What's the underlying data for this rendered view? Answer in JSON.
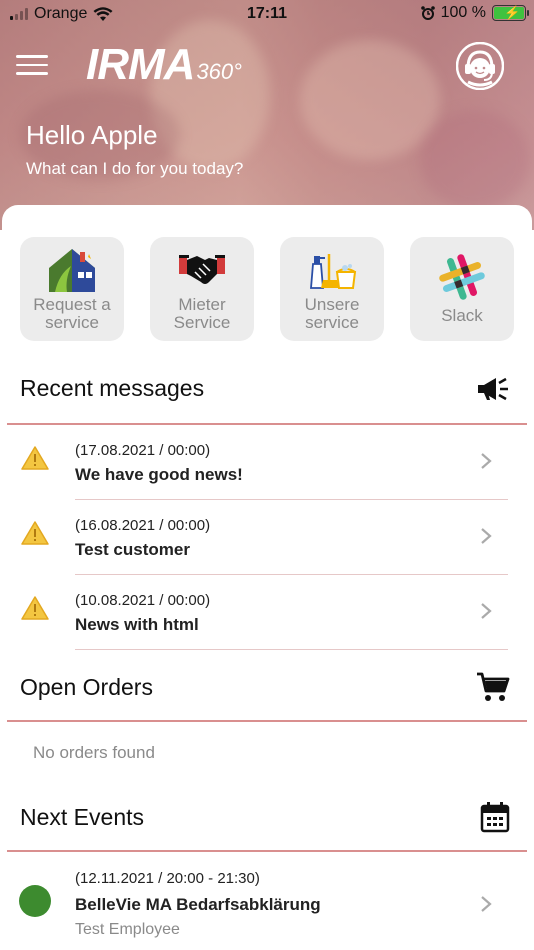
{
  "status_bar": {
    "carrier": "Orange",
    "time": "17:11",
    "battery": "100 %"
  },
  "header": {
    "logo_main": "IRMA",
    "logo_sub": "360°",
    "greeting": "Hello Apple",
    "subtitle": "What can I do for you today?"
  },
  "tiles": [
    {
      "label": "Request a service",
      "icon": "house-icon"
    },
    {
      "label": "Mieter Service",
      "icon": "handshake-icon"
    },
    {
      "label": "Unsere service",
      "icon": "cleaning-icon"
    },
    {
      "label": "Slack",
      "icon": "slack-icon"
    }
  ],
  "recent_messages": {
    "title": "Recent messages",
    "items": [
      {
        "date": "(17.08.2021 / 00:00)",
        "subject": "We have good news!"
      },
      {
        "date": "(16.08.2021 / 00:00)",
        "subject": "Test customer"
      },
      {
        "date": "(10.08.2021 / 00:00)",
        "subject": "News with html"
      }
    ]
  },
  "open_orders": {
    "title": "Open Orders",
    "empty_text": "No orders found"
  },
  "next_events": {
    "title": "Next Events",
    "items": [
      {
        "date": "(12.11.2021 / 20:00 - 21:30)",
        "title": "BelleVie MA Bedarfsabklärung",
        "person": "Test Employee"
      }
    ]
  },
  "colors": {
    "accent_divider": "#d98f8f",
    "warning": "#f3c641",
    "event_dot": "#3d8b2f"
  }
}
